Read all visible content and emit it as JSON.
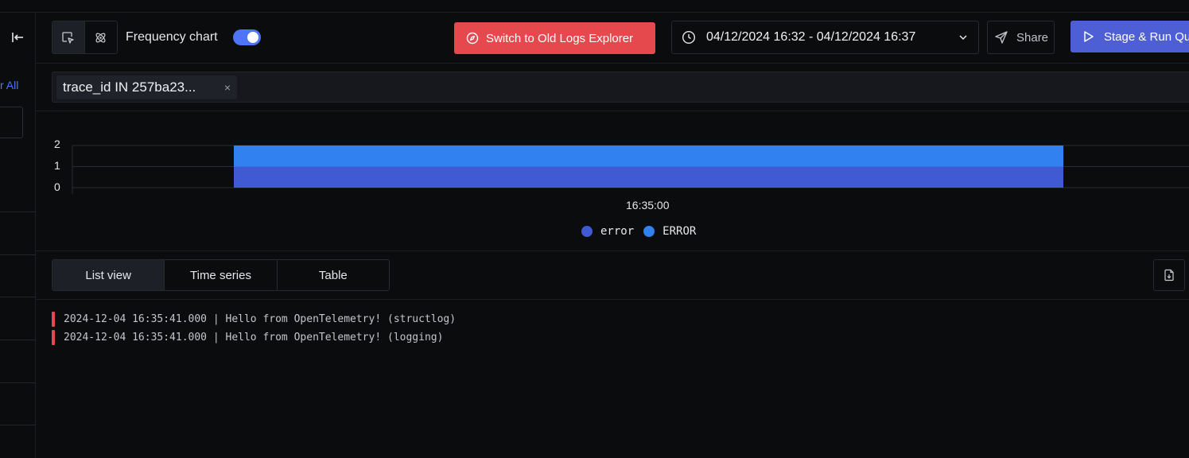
{
  "sidebar": {
    "clear_all": "r All"
  },
  "toolbar": {
    "frequency_label": "Frequency chart",
    "frequency_enabled": true,
    "switch_label": "Switch to Old Logs Explorer",
    "time_range": "04/12/2024 16:32 - 04/12/2024 16:37",
    "share_label": "Share",
    "stage_label": "Stage & Run Qu"
  },
  "query": {
    "chip_label": "trace_id IN 257ba23...",
    "chip_remove": "×"
  },
  "chart_data": {
    "type": "bar",
    "stacked": true,
    "categories": [
      "16:35:00"
    ],
    "yticks": [
      "2",
      "1",
      "0"
    ],
    "ylim": [
      0,
      2
    ],
    "series": [
      {
        "name": "error",
        "values": [
          1
        ],
        "color": "#3f5ad3"
      },
      {
        "name": "ERROR",
        "values": [
          1
        ],
        "color": "#3182f0"
      }
    ],
    "legend": "bottom-center",
    "grid": true
  },
  "tabs": [
    "List view",
    "Time series",
    "Table"
  ],
  "active_tab": "List view",
  "logs": [
    {
      "level": "error",
      "text": "2024-12-04 16:35:41.000 | Hello from OpenTelemetry! (structlog)"
    },
    {
      "level": "error",
      "text": "2024-12-04 16:35:41.000 | Hello from OpenTelemetry! (logging)"
    }
  ],
  "colors": {
    "accent": "#4e74f8",
    "danger": "#e5484d",
    "stage": "#4e5fd6"
  }
}
